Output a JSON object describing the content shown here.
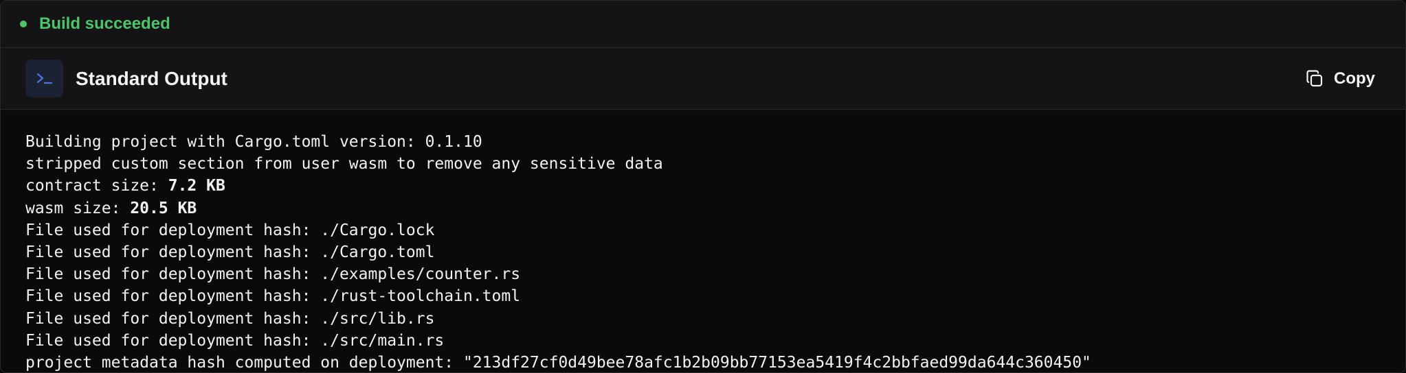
{
  "status": {
    "text": "Build succeeded",
    "color": "#4cc569"
  },
  "output": {
    "title": "Standard Output",
    "icon": "terminal-prompt-icon",
    "icon_color": "#4a78e0",
    "copy_label": "Copy"
  },
  "console_lines": [
    {
      "text": "Building project with Cargo.toml version: 0.1.10"
    },
    {
      "text": "stripped custom section from user wasm to remove any sensitive data"
    },
    {
      "prefix": "contract size: ",
      "bold": "7.2 KB"
    },
    {
      "prefix": "wasm size: ",
      "bold": "20.5 KB"
    },
    {
      "text": "File used for deployment hash: ./Cargo.lock"
    },
    {
      "text": "File used for deployment hash: ./Cargo.toml"
    },
    {
      "text": "File used for deployment hash: ./examples/counter.rs"
    },
    {
      "text": "File used for deployment hash: ./rust-toolchain.toml"
    },
    {
      "text": "File used for deployment hash: ./src/lib.rs"
    },
    {
      "text": "File used for deployment hash: ./src/main.rs"
    },
    {
      "text": "project metadata hash computed on deployment: \"213df27cf0d49bee78afc1b2b09bb77153ea5419f4c2bbfaed99da644c360450\""
    }
  ]
}
